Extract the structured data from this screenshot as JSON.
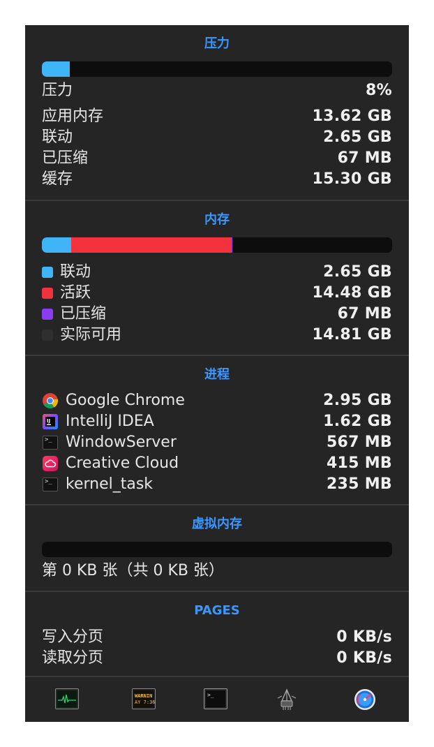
{
  "pressure": {
    "title": "压力",
    "fraction": 0.08,
    "color": "#3fb4f7",
    "rows": [
      {
        "label": "压力",
        "value": "8%"
      },
      {
        "label": "应用内存",
        "value": "13.62 GB"
      },
      {
        "label": "联动",
        "value": "2.65 GB"
      },
      {
        "label": "已压缩",
        "value": "67 MB"
      },
      {
        "label": "缓存",
        "value": "15.30 GB"
      }
    ]
  },
  "memory": {
    "title": "内存",
    "segments": [
      {
        "name": "wired",
        "fraction": 0.083,
        "color": "#3fb4f7"
      },
      {
        "name": "active",
        "fraction": 0.456,
        "color": "#f2323d"
      },
      {
        "name": "compressed",
        "fraction": 0.004,
        "color": "#8a3df0"
      }
    ],
    "rows": [
      {
        "label": "联动",
        "value": "2.65 GB",
        "color": "#3fb4f7"
      },
      {
        "label": "活跃",
        "value": "14.48 GB",
        "color": "#f2323d"
      },
      {
        "label": "已压缩",
        "value": "67 MB",
        "color": "#8a3df0"
      },
      {
        "label": "实际可用",
        "value": "14.81 GB",
        "color": "#2f2f2f"
      }
    ]
  },
  "processes": {
    "title": "进程",
    "rows": [
      {
        "label": "Google Chrome",
        "value": "2.95 GB",
        "icon": "chrome-icon"
      },
      {
        "label": "IntelliJ IDEA",
        "value": "1.62 GB",
        "icon": "intellij-icon"
      },
      {
        "label": "WindowServer",
        "value": "567 MB",
        "icon": "terminal-icon"
      },
      {
        "label": "Creative Cloud",
        "value": "415 MB",
        "icon": "creative-cloud-icon"
      },
      {
        "label": "kernel_task",
        "value": "235 MB",
        "icon": "terminal-icon"
      }
    ]
  },
  "virtual_memory": {
    "title": "虚拟内存",
    "fraction": 0,
    "summary": "第 0 KB 张（共 0 KB 张）"
  },
  "pages": {
    "title": "PAGES",
    "rows": [
      {
        "label": "写入分页",
        "value": "0 KB/s"
      },
      {
        "label": "读取分页",
        "value": "0 KB/s"
      }
    ]
  },
  "toolbar": {
    "buttons": [
      {
        "name": "activity-monitor-icon"
      },
      {
        "name": "console-icon",
        "text_top": "WARNIN",
        "text_bottom": "AY 7:36"
      },
      {
        "name": "terminal-icon"
      },
      {
        "name": "network-utility-icon"
      },
      {
        "name": "istat-menus-icon"
      }
    ]
  }
}
